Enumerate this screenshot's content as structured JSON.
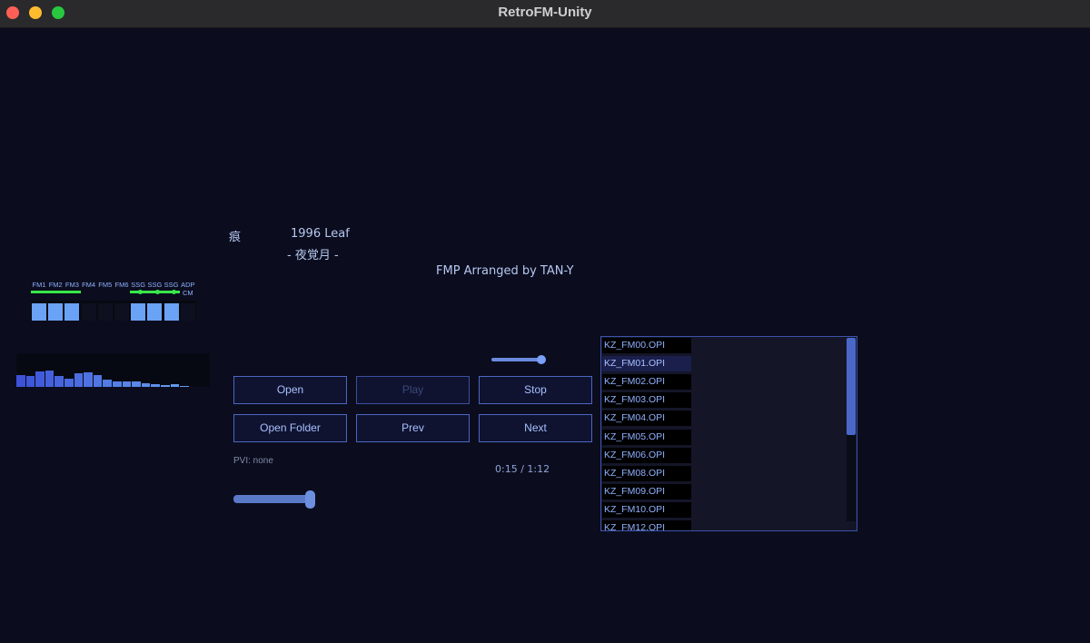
{
  "window": {
    "title": "RetroFM-Unity"
  },
  "song": {
    "title": "痕",
    "year_company": "1996 Leaf",
    "subtitle": "- 夜覚月 -",
    "arranger": "FMP Arranged by TAN-Y"
  },
  "channels": [
    {
      "label": "FM1",
      "active": true
    },
    {
      "label": "FM2",
      "active": true
    },
    {
      "label": "FM3",
      "active": true
    },
    {
      "label": "FM4",
      "active": false
    },
    {
      "label": "FM5",
      "active": false
    },
    {
      "label": "FM6",
      "active": false
    },
    {
      "label": "SSG",
      "active": true
    },
    {
      "label": "SSG",
      "active": true
    },
    {
      "label": "SSG",
      "active": true
    },
    {
      "label": "ADP\nCM",
      "active": false
    }
  ],
  "spectrum": {
    "levels": [
      0.45,
      0.42,
      0.58,
      0.62,
      0.42,
      0.32,
      0.52,
      0.55,
      0.45,
      0.28,
      0.2,
      0.22,
      0.2,
      0.14,
      0.12,
      0.08,
      0.12,
      0.03,
      0,
      0
    ],
    "colors": [
      "#3d52d8",
      "#6aa8f0"
    ]
  },
  "volume": {
    "level": 0.95
  },
  "buttons": {
    "open": "Open",
    "play": "Play",
    "stop": "Stop",
    "open_folder": "Open Folder",
    "prev": "Prev",
    "next": "Next"
  },
  "pvi": "PVI: none",
  "time": "0:15 / 1:12",
  "seek": {
    "level": 1.0
  },
  "playlist": {
    "items": [
      "KZ_FM00.OPI",
      "KZ_FM01.OPI",
      "KZ_FM02.OPI",
      "KZ_FM03.OPI",
      "KZ_FM04.OPI",
      "KZ_FM05.OPI",
      "KZ_FM06.OPI",
      "KZ_FM08.OPI",
      "KZ_FM09.OPI",
      "KZ_FM10.OPI",
      "KZ_FM12.OPI"
    ],
    "selected_index": 1,
    "scroll_fraction": 0.53
  }
}
